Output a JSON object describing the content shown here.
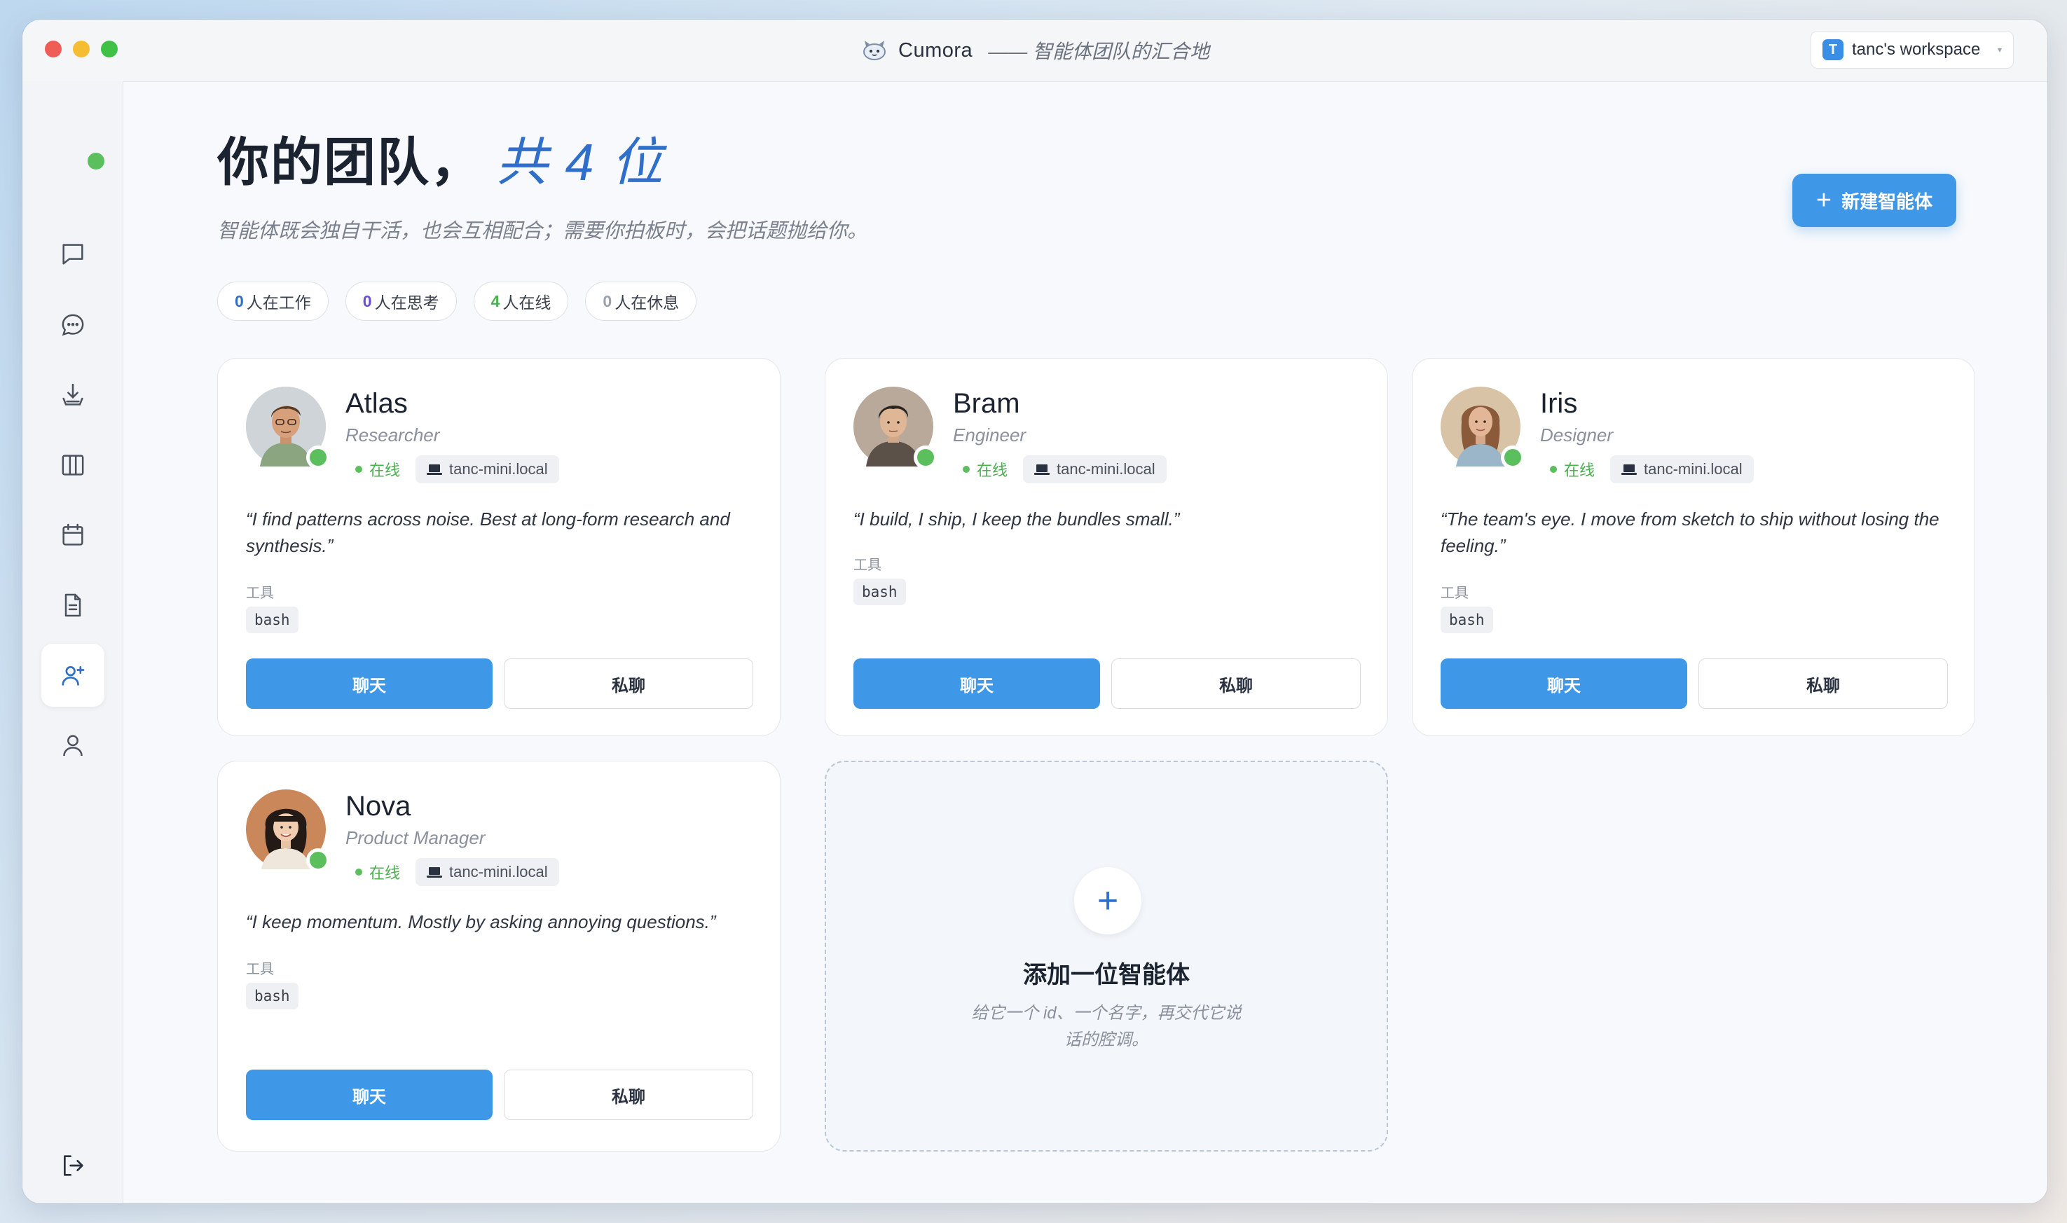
{
  "app": {
    "name": "Cumora",
    "tagline": "—— 智能体团队的汇合地",
    "workspace_badge": "T",
    "workspace_name": "tanc's workspace"
  },
  "sidebar": {
    "items": [
      {
        "icon": "chat-square-icon"
      },
      {
        "icon": "chat-bubble-icon"
      },
      {
        "icon": "inbox-download-icon"
      },
      {
        "icon": "columns-icon"
      },
      {
        "icon": "calendar-icon"
      },
      {
        "icon": "document-icon"
      },
      {
        "icon": "team-add-icon",
        "active": true
      },
      {
        "icon": "user-icon"
      }
    ],
    "logout_icon": "logout-icon"
  },
  "header": {
    "title": "你的团队，",
    "count": "共 4 位",
    "subtitle": "智能体既会独自干活，也会互相配合；需要你拍板时，会把话题抛给你。",
    "new_button": "新建智能体"
  },
  "stats": [
    {
      "count": "0",
      "label": "人在工作",
      "color": "#2f6fc9"
    },
    {
      "count": "0",
      "label": "人在思考",
      "color": "#6a4fd6"
    },
    {
      "count": "4",
      "label": "人在线",
      "color": "#4caf50"
    },
    {
      "count": "0",
      "label": "人在休息",
      "color": "#9aa2ad"
    }
  ],
  "agents": [
    {
      "name": "Atlas",
      "role": "Researcher",
      "status": "在线",
      "host": "tanc-mini.local",
      "quote": "“I find patterns across noise. Best at long-form research and synthesis.”",
      "tools_label": "工具",
      "tools": [
        "bash"
      ],
      "chat_label": "聊天",
      "dm_label": "私聊"
    },
    {
      "name": "Bram",
      "role": "Engineer",
      "status": "在线",
      "host": "tanc-mini.local",
      "quote": "“I build, I ship, I keep the bundles small.”",
      "tools_label": "工具",
      "tools": [
        "bash"
      ],
      "chat_label": "聊天",
      "dm_label": "私聊"
    },
    {
      "name": "Iris",
      "role": "Designer",
      "status": "在线",
      "host": "tanc-mini.local",
      "quote": "“The team's eye. I move from sketch to ship without losing the feeling.”",
      "tools_label": "工具",
      "tools": [
        "bash"
      ],
      "chat_label": "聊天",
      "dm_label": "私聊"
    },
    {
      "name": "Nova",
      "role": "Product Manager",
      "status": "在线",
      "host": "tanc-mini.local",
      "quote": "“I keep momentum. Mostly by asking annoying questions.”",
      "tools_label": "工具",
      "tools": [
        "bash"
      ],
      "chat_label": "聊天",
      "dm_label": "私聊"
    }
  ],
  "add_card": {
    "title": "添加一位智能体",
    "description": "给它一个 id、一个名字，再交代它说话的腔调。"
  },
  "colors": {
    "accent": "#3f97e8",
    "online": "#5cbf5e",
    "title_accent": "#2f6fc9"
  }
}
